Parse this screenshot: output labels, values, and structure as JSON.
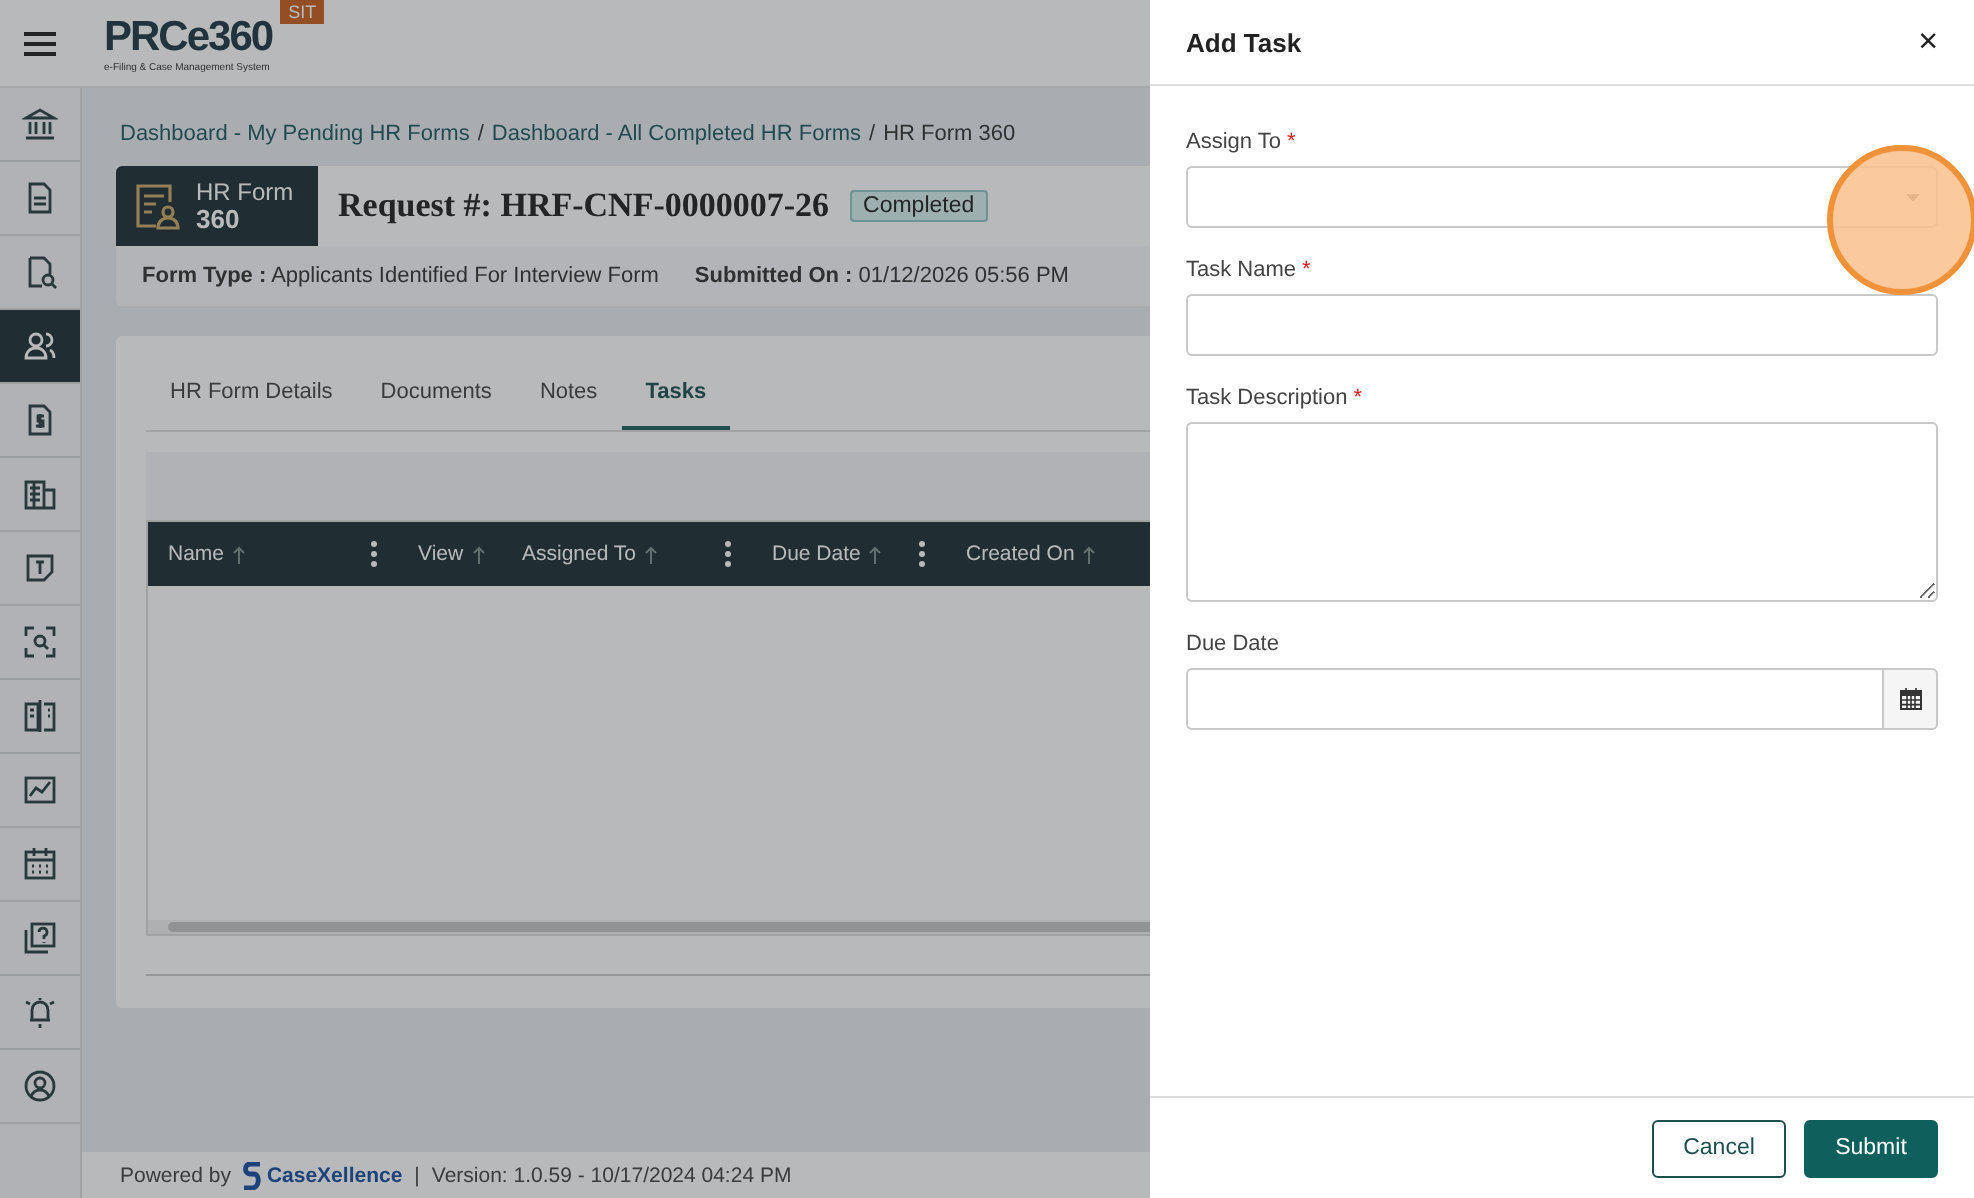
{
  "header": {
    "logo_text": "PRCe360",
    "logo_tagline": "e-Filing & Case Management System",
    "env_badge": "SIT"
  },
  "sidebar": {
    "items": [
      {
        "selected": false
      },
      {
        "selected": false
      },
      {
        "selected": false
      },
      {
        "selected": true
      },
      {
        "selected": false
      },
      {
        "selected": false
      },
      {
        "selected": false
      },
      {
        "selected": false
      },
      {
        "selected": false
      },
      {
        "selected": false
      },
      {
        "selected": false
      },
      {
        "selected": false
      },
      {
        "selected": false
      },
      {
        "selected": false
      }
    ]
  },
  "breadcrumb": [
    {
      "label": "Dashboard - My Pending HR Forms",
      "link": true,
      "separator": "/"
    },
    {
      "label": "Dashboard - All Completed HR Forms",
      "link": true,
      "separator": "/"
    },
    {
      "label": "HR Form 360",
      "link": false
    }
  ],
  "form_badge": {
    "line1": "HR Form",
    "line2": "360"
  },
  "request": {
    "label": "Request #:",
    "number": "HRF-CNF-0000007-26",
    "status": "Completed"
  },
  "meta": [
    {
      "label": "Form Type :",
      "value": "Applicants Identified For Interview Form"
    },
    {
      "label": "Submitted On :",
      "value": "01/12/2026 05:56 PM"
    }
  ],
  "tabs": [
    {
      "label": "HR Form Details",
      "selected": false
    },
    {
      "label": "Documents",
      "selected": false
    },
    {
      "label": "Notes",
      "selected": false
    },
    {
      "label": "Tasks",
      "selected": true
    }
  ],
  "table": {
    "columns": [
      {
        "label": "Name",
        "menu": true
      },
      {
        "label": "View",
        "menu": false
      },
      {
        "label": "Assigned To",
        "menu": true
      },
      {
        "label": "Due Date",
        "menu": true
      },
      {
        "label": "Created On",
        "menu": false
      }
    ]
  },
  "footer": {
    "powered_by": "Powered by",
    "brand": "CaseXellence",
    "separator": "|",
    "version": "Version: 1.0.59 - 10/17/2024 04:24 PM"
  },
  "drawer": {
    "title": "Add Task",
    "close": "×",
    "fields": [
      {
        "label": "Assign To",
        "required_mark": "*",
        "kind": "select"
      },
      {
        "label": "Task Name",
        "required_mark": "*",
        "kind": "text"
      },
      {
        "label": "Task Description",
        "required_mark": "*",
        "kind": "textarea"
      },
      {
        "label": "Due Date",
        "kind": "date"
      }
    ],
    "buttons": [
      {
        "label": "Cancel",
        "primary": false
      },
      {
        "label": "Submit",
        "primary": true
      }
    ]
  }
}
